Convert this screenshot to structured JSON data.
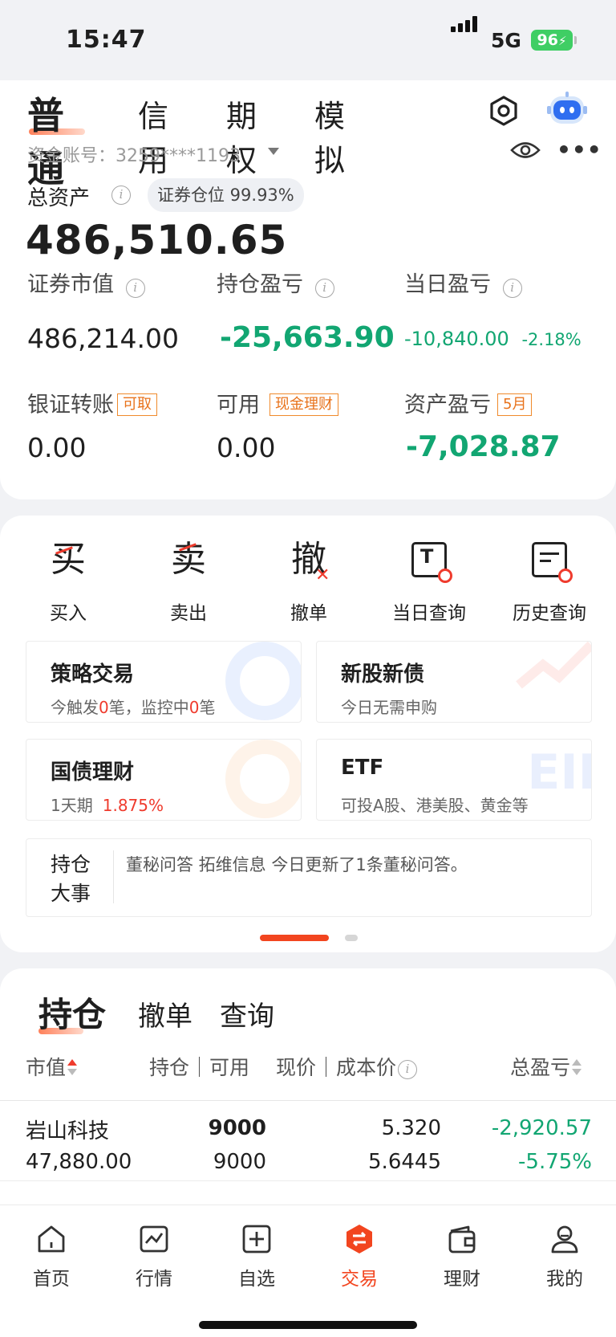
{
  "status_bar": {
    "time": "15:47",
    "network": "5G",
    "battery": "96"
  },
  "account": {
    "tabs": [
      "普通",
      "信用",
      "期权",
      "模拟"
    ],
    "active_tab": "普通",
    "account_label": "资金账号：3259****1193",
    "total_assets_label": "总资产",
    "position_ratio": "证券仓位 99.93%",
    "total_assets_value": "486,510.65",
    "metrics": {
      "market_value_label": "证券市值",
      "market_value": "486,214.00",
      "holding_pl_label": "持仓盈亏",
      "holding_pl": "-25,663.90",
      "daily_pl_label": "当日盈亏",
      "daily_pl": "-10,840.00",
      "daily_pl_pct": "-2.18%",
      "transfer_label": "银证转账",
      "transfer_tag": "可取",
      "transfer_value": "0.00",
      "available_label": "可用",
      "available_tag": "现金理财",
      "available_value": "0.00",
      "asset_pl_label": "资产盈亏",
      "asset_pl_tag": "5月",
      "asset_pl_value": "-7,028.87"
    }
  },
  "functions": [
    {
      "glyph": "买",
      "label": "买入"
    },
    {
      "glyph": "卖",
      "label": "卖出"
    },
    {
      "glyph": "撤",
      "label": "撤单"
    },
    {
      "glyph": "T",
      "label": "当日查询"
    },
    {
      "glyph": "",
      "label": "历史查询"
    }
  ],
  "boxes": {
    "strategy": {
      "title": "策略交易",
      "sub_a": "今触发",
      "count_a": "0",
      "sub_b": "笔，监控中",
      "count_b": "0",
      "sub_c": "笔"
    },
    "ipo": {
      "title": "新股新债",
      "sub": "今日无需申购"
    },
    "bond": {
      "title": "国债理财",
      "sub_a": "1天期",
      "rate": "1.875%"
    },
    "etf": {
      "title": "ETF",
      "sub": "可投A股、港美股、黄金等"
    }
  },
  "news": {
    "label_line1": "持仓",
    "label_line2": "大事",
    "content": "董秘问答 拓维信息 今日更新了1条董秘问答。"
  },
  "holdings": {
    "tabs": [
      "持仓",
      "撤单",
      "查询"
    ],
    "columns": {
      "market_value": "市值",
      "position": "持仓｜可用",
      "price": "现价｜成本价",
      "pl": "总盈亏"
    },
    "rows": [
      {
        "name": "岩山科技",
        "market_value": "47,880.00",
        "position": "9000",
        "available": "9000",
        "price": "5.320",
        "cost": "5.6445",
        "pl": "-2,920.57",
        "pl_pct": "-5.75%"
      }
    ]
  },
  "bottom_nav": [
    {
      "label": "首页",
      "icon": "home-icon"
    },
    {
      "label": "行情",
      "icon": "chart-icon"
    },
    {
      "label": "自选",
      "icon": "plus-square-icon"
    },
    {
      "label": "交易",
      "icon": "trade-icon"
    },
    {
      "label": "理财",
      "icon": "wallet-icon"
    },
    {
      "label": "我的",
      "icon": "profile-icon"
    }
  ],
  "colors": {
    "accent": "#f2451f",
    "loss": "#12a672",
    "gain": "#ef3b2d",
    "tag": "#f08a2c"
  }
}
